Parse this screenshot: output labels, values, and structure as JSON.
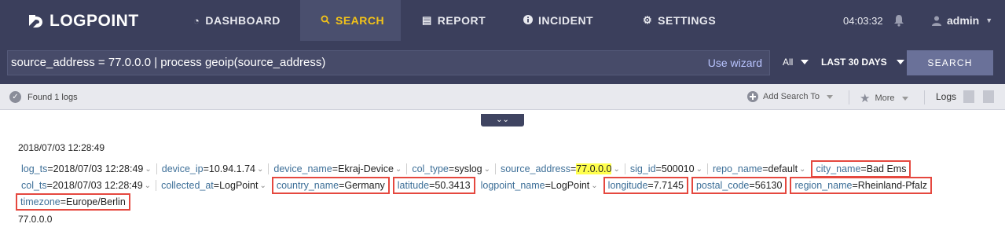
{
  "app": {
    "logo_text": "LOGPOINT"
  },
  "nav": {
    "dashboard": "DASHBOARD",
    "search": "SEARCH",
    "report": "REPORT",
    "incident": "INCIDENT",
    "settings": "SETTINGS"
  },
  "header": {
    "time": "04:03:32",
    "user": "admin"
  },
  "query": {
    "text": "source_address = 77.0.0.0 | process geoip(source_address)",
    "wizard": "Use wizard",
    "repo_select": "All",
    "range_select": "LAST 30 DAYS",
    "search_button": "SEARCH"
  },
  "status": {
    "found": "Found 1 logs",
    "add_search": "Add Search To",
    "more": "More",
    "logs_label": "Logs"
  },
  "result": {
    "timestamp": "2018/07/03 12:28:49",
    "raw": "77.0.0.0",
    "row1": [
      {
        "key": "log_ts",
        "value": "2018/07/03 12:28:49"
      },
      {
        "key": "device_ip",
        "value": "10.94.1.74"
      },
      {
        "key": "device_name",
        "value": "Ekraj-Device"
      },
      {
        "key": "col_type",
        "value": "syslog"
      },
      {
        "key": "source_address",
        "value": "77.0.0.0"
      },
      {
        "key": "sig_id",
        "value": "500010"
      },
      {
        "key": "repo_name",
        "value": "default"
      },
      {
        "key": "city_name",
        "value": "Bad Ems"
      }
    ],
    "row2": [
      {
        "key": "col_ts",
        "value": "2018/07/03 12:28:49"
      },
      {
        "key": "collected_at",
        "value": "LogPoint"
      },
      {
        "key": "country_name",
        "value": "Germany"
      },
      {
        "key": "latitude",
        "value": "50.3413"
      },
      {
        "key": "logpoint_name",
        "value": "LogPoint"
      },
      {
        "key": "longitude",
        "value": "7.7145"
      },
      {
        "key": "postal_code",
        "value": "56130"
      },
      {
        "key": "region_name",
        "value": "Rheinland-Pfalz"
      }
    ],
    "row3": [
      {
        "key": "timezone",
        "value": "Europe/Berlin"
      }
    ]
  },
  "colors": {
    "topbar": "#3b3f5c",
    "active_nav_text": "#f3c318",
    "highlight": "#ffff4d",
    "annotation_box": "#e5483f",
    "field_key": "#3d6f98"
  }
}
